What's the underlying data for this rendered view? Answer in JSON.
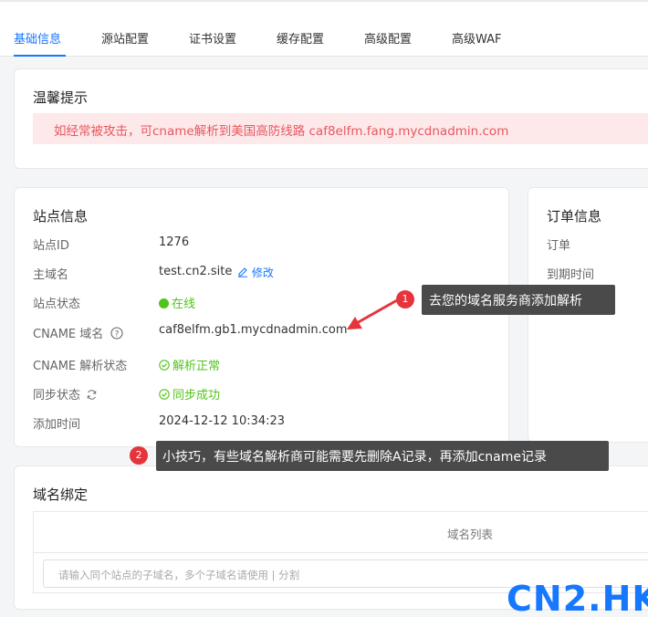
{
  "tabs": [
    {
      "label": "基础信息",
      "active": true
    },
    {
      "label": "源站配置"
    },
    {
      "label": "证书设置"
    },
    {
      "label": "缓存配置"
    },
    {
      "label": "高级配置"
    },
    {
      "label": "高级WAF"
    }
  ],
  "notice": {
    "title": "温馨提示",
    "message": "如经常被攻击，可cname解析到美国高防线路 caf8elfm.fang.mycdnadmin.com"
  },
  "site_info": {
    "title": "站点信息",
    "rows": [
      {
        "label": "站点ID",
        "value": "1276"
      },
      {
        "label": "主域名",
        "value": "test.cn2.site",
        "action": "修改"
      },
      {
        "label": "站点状态",
        "value": "在线"
      },
      {
        "label": "CNAME 域名",
        "value": "caf8elfm.gb1.mycdnadmin.com"
      },
      {
        "label": "CNAME 解析状态",
        "value": "解析正常"
      },
      {
        "label": "同步状态",
        "value": "同步成功"
      },
      {
        "label": "添加时间",
        "value": "2024-12-12 10:34:23"
      }
    ]
  },
  "order_info": {
    "title": "订单信息",
    "rows": [
      {
        "label": "订单"
      },
      {
        "label": "到期时间"
      }
    ]
  },
  "callouts": [
    {
      "number": "1",
      "text": "去您的域名服务商添加解析"
    },
    {
      "number": "2",
      "text": "小技巧，有些域名解析商可能需要先删除A记录，再添加cname记录"
    }
  ],
  "domain_binding": {
    "title": "域名绑定",
    "column_header": "域名列表",
    "input_placeholder": "请输入同个站点的子域名，多个子域名请使用 | 分割"
  },
  "watermark": "CN2.HK",
  "colors": {
    "accent": "#1677ff",
    "success": "#52c41a",
    "alert_text": "#e8585e",
    "alert_bg": "#fde8ea",
    "badge": "#e5343b"
  }
}
